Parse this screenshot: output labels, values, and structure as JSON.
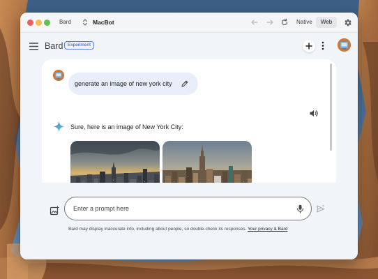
{
  "window": {
    "app_name": "Bard",
    "title": "MacBot",
    "mode_native": "Native",
    "mode_web": "Web"
  },
  "header": {
    "brand": "Bard",
    "badge": "Experiment"
  },
  "conversation": {
    "prompt": "generate an image of new york city",
    "response": "Sure, here is an image of New York City:"
  },
  "composer": {
    "placeholder": "Enter a prompt here"
  },
  "footer": {
    "disclaimer": "Bard may display inaccurate info, including about people, so double-check its responses.",
    "privacy_link": "Your privacy & Bard"
  },
  "colors": {
    "accent": "#1a73e8",
    "bubble": "#e8effb",
    "app_background": "#f1f4f9"
  }
}
